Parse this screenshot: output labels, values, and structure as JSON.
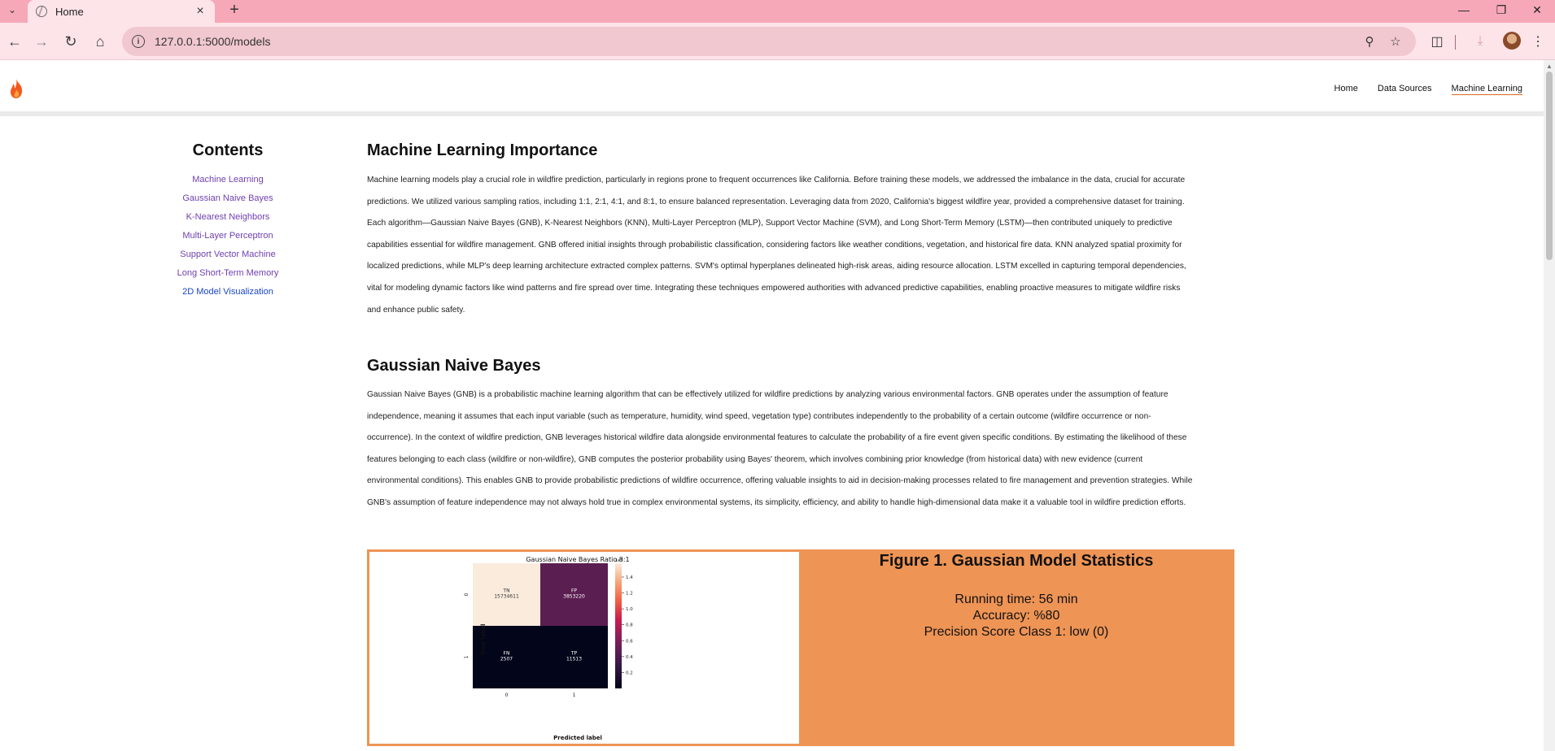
{
  "browser": {
    "tab_title": "Home",
    "url": "127.0.0.1:5000/models",
    "new_tab_symbol": "+",
    "icons": [
      "tab-search-icon",
      "globe-icon",
      "close-icon",
      "back-icon",
      "forward-icon",
      "reload-icon",
      "home-icon",
      "site-info-icon",
      "zoom-icon",
      "bookmark-star-icon",
      "extensions-icon",
      "download-icon",
      "profile-avatar",
      "menu-icon"
    ]
  },
  "site": {
    "brand_icon": "flame-icon",
    "accent_color": "#ee9455",
    "nav": [
      {
        "label": "Home"
      },
      {
        "label": "Data Sources"
      },
      {
        "label": "Machine Learning",
        "active": true
      }
    ]
  },
  "contents": {
    "title": "Contents",
    "links": [
      "Machine Learning",
      "Gaussian Naive Bayes",
      "K-Nearest Neighbors",
      "Multi-Layer Perceptron",
      "Support Vector Machine",
      "Long Short-Term Memory",
      "2D Model Visualization"
    ]
  },
  "sections": {
    "ml": {
      "title": "Machine Learning Importance",
      "lines": [
        "Machine learning models play a crucial role in wildfire prediction, particularly in regions prone to frequent occurrences like California. Before training these models, we addressed the imbalance in the data, crucial for accurate",
        "predictions. We utilized various sampling ratios, including 1:1, 2:1, 4:1, and 8:1, to ensure balanced representation. Leveraging data from 2020, California's biggest wildfire year, provided a comprehensive dataset for training.",
        "Each algorithm—Gaussian Naive Bayes (GNB), K-Nearest Neighbors (KNN), Multi-Layer Perceptron (MLP), Support Vector Machine (SVM), and Long Short-Term Memory (LSTM)—then contributed uniquely to predictive",
        "capabilities essential for wildfire management. GNB offered initial insights through probabilistic classification, considering factors like weather conditions, vegetation, and historical fire data. KNN analyzed spatial proximity for",
        "localized predictions, while MLP's deep learning architecture extracted complex patterns. SVM's optimal hyperplanes delineated high-risk areas, aiding resource allocation. LSTM excelled in capturing temporal dependencies,",
        "vital for modeling dynamic factors like wind patterns and fire spread over time. Integrating these techniques empowered authorities with advanced predictive capabilities, enabling proactive measures to mitigate wildfire risks",
        "and enhance public safety."
      ]
    },
    "gnb": {
      "title": "Gaussian Naive Bayes",
      "lines": [
        "Gaussian Naive Bayes (GNB) is a probabilistic machine learning algorithm that can be effectively utilized for wildfire predictions by analyzing various environmental factors. GNB operates under the assumption of feature",
        "independence, meaning it assumes that each input variable (such as temperature, humidity, wind speed, vegetation type) contributes independently to the probability of a certain outcome (wildfire occurrence or non-",
        "occurrence). In the context of wildfire prediction, GNB leverages historical wildfire data alongside environmental features to calculate the probability of a fire event given specific conditions. By estimating the likelihood of these",
        "features belonging to each class (wildfire or non-wildfire), GNB computes the posterior probability using Bayes' theorem, which involves combining prior knowledge (from historical data) with new evidence (current",
        "environmental conditions). This enables GNB to provide probabilistic predictions of wildfire occurrence, offering valuable insights to aid in decision-making processes related to fire management and prevention strategies. While",
        "GNB's assumption of feature independence may not always hold true in complex environmental systems, its simplicity, efficiency, and ability to handle high-dimensional data make it a valuable tool in wildfire prediction efforts."
      ]
    }
  },
  "figure": {
    "title": "Figure 1. Gaussian Model Statistics",
    "stats": [
      "Running time: 56 min",
      "Accuracy: %80",
      "Precision Score Class 1: low (0)"
    ]
  },
  "chart_data": {
    "type": "heatmap",
    "title": "Gaussian Naive Bayes Ratio 8:1",
    "xlabel": "Predicted label",
    "ylabel": "True label",
    "x_ticks": [
      "0",
      "1"
    ],
    "y_ticks": [
      "0",
      "1"
    ],
    "cells": [
      {
        "row": 0,
        "col": 0,
        "label": "TN",
        "value": "15734611",
        "color": "#faebdd"
      },
      {
        "row": 0,
        "col": 1,
        "label": "FP",
        "value": "3853220",
        "color": "#5b1e51"
      },
      {
        "row": 1,
        "col": 0,
        "label": "FN",
        "value": "2507",
        "color": "#03051a"
      },
      {
        "row": 1,
        "col": 1,
        "label": "TP",
        "value": "11513",
        "color": "#03051a"
      }
    ],
    "colorbar": {
      "exponent": "1e7",
      "ticks": [
        "1.4",
        "1.2",
        "1.0",
        "0.8",
        "0.6",
        "0.4",
        "0.2"
      ],
      "tick_values": [
        1.4,
        1.2,
        1.0,
        0.8,
        0.6,
        0.4,
        0.2
      ],
      "min": 0.0,
      "max": 1.5734611,
      "colormap": "rocket"
    }
  }
}
